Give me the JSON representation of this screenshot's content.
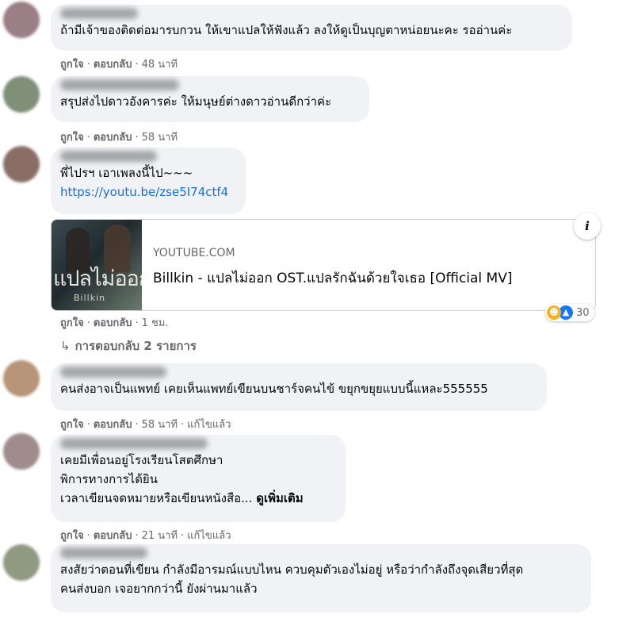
{
  "comments": [
    {
      "lines": [
        "ถ้ามีเจ้าของติดต่อมารบกวน ให้เขาแปลให้ฟังแล้ว ลงให้ดูเป็นบุญตาหน่อยนะคะ รออ่านค่ะ"
      ],
      "like": "ถูกใจ",
      "reply": "ตอบกลับ",
      "time": "48 นาที"
    },
    {
      "lines": [
        "สรุปส่งไปดาวอังคารค่ะ ให้มนุษย์ต่างดาวอ่านดีกว่าค่ะ"
      ],
      "like": "ถูกใจ",
      "reply": "ตอบกลับ",
      "time": "58 นาที"
    },
    {
      "lines": [
        "พี่ไปรฯ เอาเพลงนี้ไป~~~"
      ],
      "link": "https://youtu.be/zse5I74ctf4",
      "like": "ถูกใจ",
      "reply": "ตอบกลับ",
      "time": "1 ชม.",
      "preview": {
        "source": "YOUTUBE.COM",
        "title": "Billkin - แปลไม่ออก OST.แปลรักฉันด้วยใจเธอ [Official MV]",
        "thumb_text": "แปลไม่ออก",
        "thumb_subtext": "Billkin",
        "info": "i"
      },
      "reactions": {
        "icons": [
          "haha-icon",
          "like-icon"
        ],
        "count": "30"
      },
      "replies_label": "การตอบกลับ 2 รายการ"
    },
    {
      "lines": [
        "คนส่งอาจเป็นแพทย์ เคยเห็นแพทย์เขียนบนชาร์จคนไข้ ขยุกขยุยแบบนี้แหละ555555"
      ],
      "like": "ถูกใจ",
      "reply": "ตอบกลับ",
      "time": "58 นาที",
      "edited": "แก้ไขแล้ว"
    },
    {
      "lines": [
        "เคยมีเพื่อนอยู่โรงเรียนโสตศึกษา",
        "พิการทางการได้ยิน",
        "เวลาเขียนจดหมายหรือเขียนหนังสือ..."
      ],
      "more": "ดูเพิ่มเติม",
      "like": "ถูกใจ",
      "reply": "ตอบกลับ",
      "time": "21 นาที",
      "edited": "แก้ไขแล้ว"
    },
    {
      "lines": [
        "สงสัยว่าตอนที่เขียน กำลังมีอารมณ์แบบไหน ควบคุมตัวเองไม่อยู่ หรือว่ากำลังถึงจุดเสียวที่สุด",
        "คนส่งบอก เจอยากกว่านี้ ยังผ่านมาแล้ว"
      ]
    }
  ]
}
